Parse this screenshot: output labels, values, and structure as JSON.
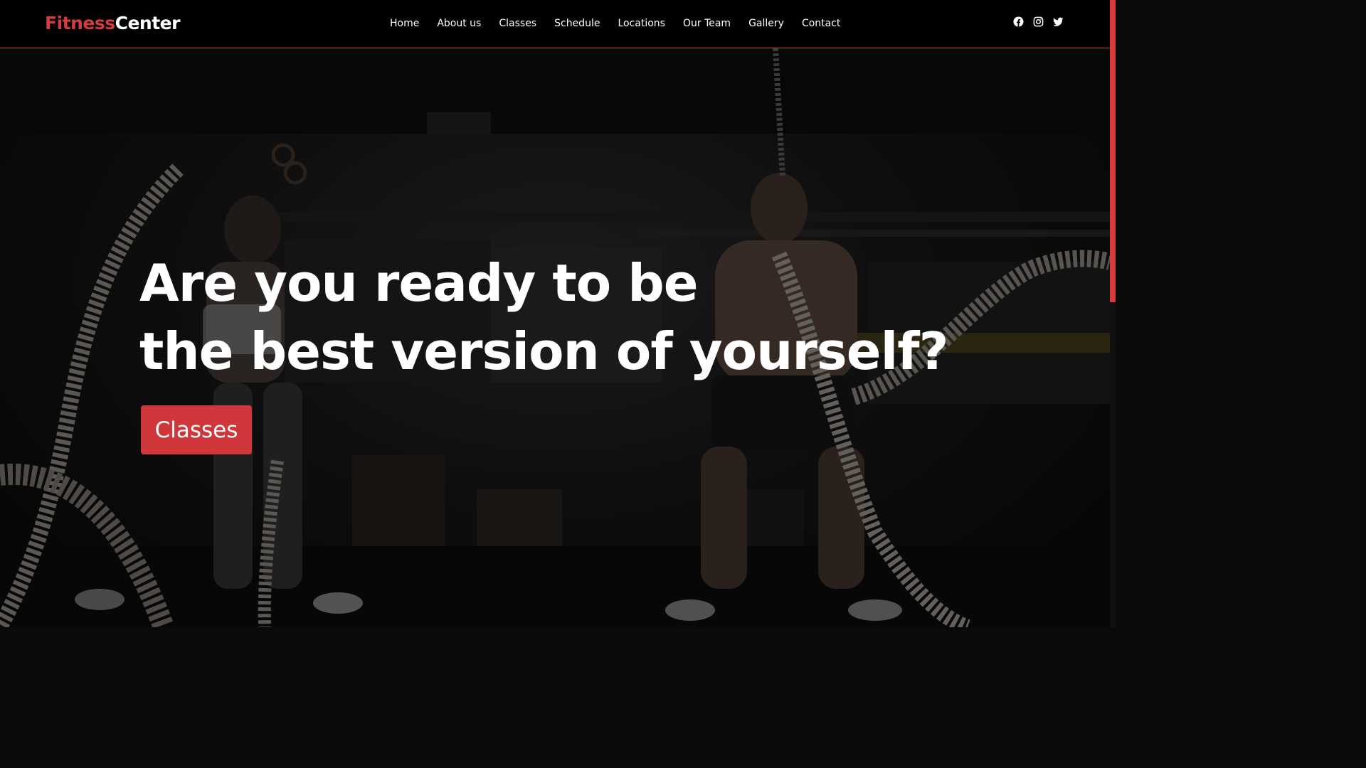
{
  "brand": {
    "part1": "Fitness",
    "part2": "Center",
    "accent": "#d63c3c"
  },
  "nav": [
    "Home",
    "About us",
    "Classes",
    "Schedule",
    "Locations",
    "Our Team",
    "Gallery",
    "Contact"
  ],
  "social": [
    "facebook-icon",
    "instagram-icon",
    "twitter-icon"
  ],
  "hero": {
    "line1": "Are you ready to be",
    "line2": "the best version of yourself?",
    "cta_label": "Classes",
    "cta_color": "#d0373b"
  }
}
